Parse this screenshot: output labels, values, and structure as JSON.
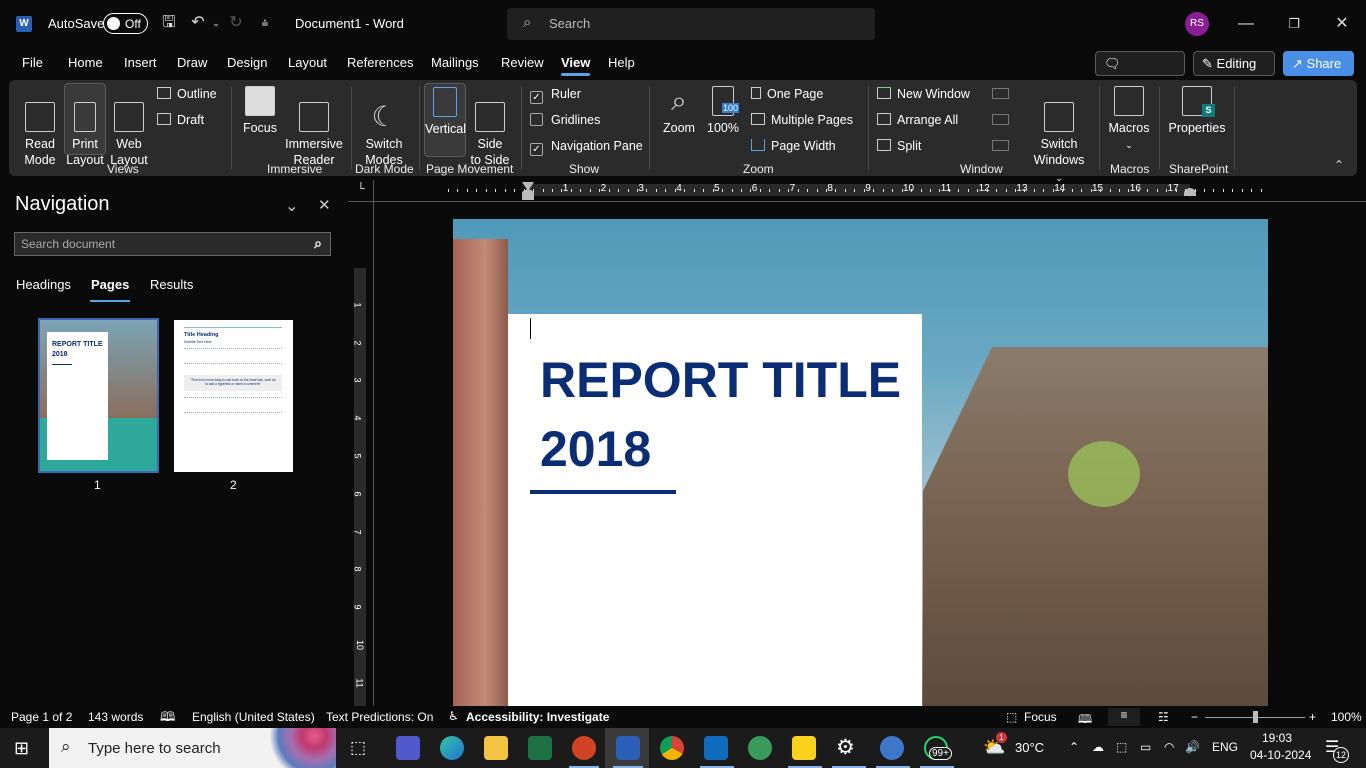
{
  "titlebar": {
    "app_icon": "word-logo-icon",
    "autosave_label": "AutoSave",
    "autosave_state": "Off",
    "doc_title": "Document1  -  Word",
    "search_placeholder": "Search",
    "avatar_initials": "RS",
    "colors": {
      "avatar": "#8a1e94",
      "accent": "#5ea3e8"
    }
  },
  "menu": {
    "items": [
      "File",
      "Home",
      "Insert",
      "Draw",
      "Design",
      "Layout",
      "References",
      "Mailings",
      "Review",
      "View",
      "Help"
    ],
    "active": "View",
    "comments_label": "Comments",
    "editing_label": "Editing",
    "share_label": "Share"
  },
  "ribbon": {
    "views": {
      "label": "Views",
      "read_mode": "Read\nMode",
      "print_layout": "Print\nLayout",
      "web_layout": "Web\nLayout",
      "outline": "Outline",
      "draft": "Draft"
    },
    "immersive": {
      "label": "Immersive",
      "focus": "Focus",
      "immersive_reader": "Immersive\nReader"
    },
    "dark_mode": {
      "label": "Dark Mode",
      "switch_modes": "Switch\nModes"
    },
    "page_movement": {
      "label": "Page Movement",
      "vertical": "Vertical",
      "side_to_side": "Side\nto Side"
    },
    "show": {
      "label": "Show",
      "ruler": "Ruler",
      "ruler_checked": true,
      "gridlines": "Gridlines",
      "gridlines_checked": false,
      "navigation_pane": "Navigation Pane",
      "navigation_pane_checked": true
    },
    "zoom": {
      "label": "Zoom",
      "zoom": "Zoom",
      "hundred": "100%",
      "hundred_badge": "100",
      "one_page": "One Page",
      "multiple_pages": "Multiple Pages",
      "page_width": "Page Width"
    },
    "window": {
      "label": "Window",
      "new_window": "New Window",
      "arrange_all": "Arrange All",
      "split": "Split",
      "switch_windows": "Switch\nWindows"
    },
    "macros": {
      "label": "Macros",
      "macros": "Macros"
    },
    "sharepoint": {
      "label": "SharePoint",
      "properties": "Properties"
    }
  },
  "navigation": {
    "title": "Navigation",
    "search_placeholder": "Search document",
    "tabs": [
      "Headings",
      "Pages",
      "Results"
    ],
    "active_tab": "Pages",
    "pages": [
      {
        "number": "1",
        "title": "REPORT TITLE",
        "year": "2018"
      },
      {
        "number": "2",
        "heading": "Title Heading",
        "subtitle": "Subtitle Text Here",
        "quote": "\"Find even more easy-to-use tools on the Insert tab, such as to add a hyperlink or insert a comment\""
      }
    ]
  },
  "ruler": {
    "h_ticks": [
      "1",
      "2",
      "3",
      "4",
      "5",
      "6",
      "7",
      "8",
      "9",
      "10",
      "11",
      "12",
      "13",
      "14",
      "15",
      "16",
      "17"
    ],
    "v_ticks": [
      "1",
      "2",
      "3",
      "4",
      "5",
      "6",
      "7",
      "8",
      "9",
      "10",
      "11"
    ]
  },
  "document": {
    "title_line1": "REPORT TITLE",
    "title_line2": "2018",
    "title_color": "#0b2d74"
  },
  "statusbar": {
    "page": "Page 1 of 2",
    "words": "143 words",
    "language": "English (United States)",
    "text_predictions": "Text Predictions: On",
    "accessibility": "Accessibility: Investigate",
    "focus": "Focus",
    "zoom_level": "100%",
    "zoom_fraction": 0.5
  },
  "taskbar": {
    "search_placeholder": "Type here to search",
    "weather": "30°C",
    "language": "ENG",
    "time": "19:03",
    "date": "04-10-2024",
    "notifications": "12",
    "whatsapp_badge": "99+",
    "weather_badge": "1",
    "apps": [
      "task-view",
      "teams",
      "edge",
      "file-explorer",
      "excel",
      "powerpoint",
      "word",
      "chrome",
      "outlook",
      "maps",
      "sticky-notes",
      "settings",
      "browser",
      "whatsapp"
    ]
  }
}
